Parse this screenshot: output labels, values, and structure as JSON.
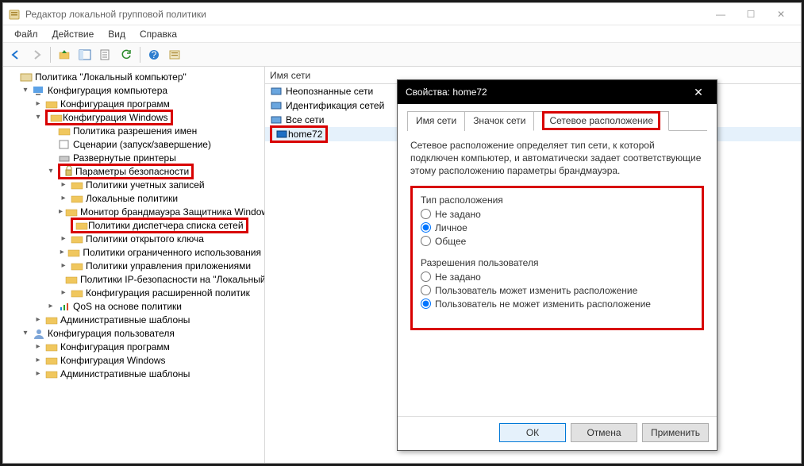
{
  "window": {
    "title": "Редактор локальной групповой политики",
    "controls": {
      "min": "—",
      "max": "☐",
      "close": "✕"
    }
  },
  "menus": [
    "Файл",
    "Действие",
    "Вид",
    "Справка"
  ],
  "tree": {
    "root": "Политика \"Локальный компьютер\"",
    "computer": "Конфигурация компьютера",
    "progconf_c": "Конфигурация программ",
    "winconf_c": "Конфигурация Windows",
    "nameres": "Политика разрешения имен",
    "scripts": "Сценарии (запуск/завершение)",
    "deployed_printers": "Развернутые принтеры",
    "secparams": "Параметры безопасности",
    "accpol": "Политики учетных записей",
    "localpol": "Локальные политики",
    "fwmon": "Монитор брандмауэра Защитника Windows",
    "netlistmgr": "Политики диспетчера списка сетей",
    "openkey": "Политики открытого ключа",
    "restricted": "Политики ограниченного использования",
    "appctrl": "Политики управления приложениями",
    "ipsec": "Политики IP-безопасности на \"Локальный",
    "advaudit": "Конфигурация расширенной политик",
    "qos": "QoS на основе политики",
    "admintpl_c": "Административные шаблоны",
    "user": "Конфигурация пользователя",
    "progconf_u": "Конфигурация программ",
    "winconf_u": "Конфигурация Windows",
    "admintpl_u": "Административные шаблоны"
  },
  "list_header": "Имя сети",
  "list_items": {
    "unid": "Неопознанные сети",
    "ident": "Идентификация сетей",
    "all": "Все сети",
    "home72": "home72"
  },
  "dialog": {
    "title": "Свойства: home72",
    "close": "✕",
    "tabs": {
      "name": "Имя сети",
      "icon": "Значок сети",
      "loc": "Сетевое расположение"
    },
    "desc": "Сетевое расположение определяет тип сети, к которой подключен компьютер, и автоматически задает соответствующие этому расположению параметры брандмауэра.",
    "group1": {
      "legend": "Тип расположения",
      "o1": "Не задано",
      "o2": "Личное",
      "o3": "Общее"
    },
    "group2": {
      "legend": "Разрешения пользователя",
      "o1": "Не задано",
      "o2": "Пользователь может изменить расположение",
      "o3": "Пользователь не может изменить расположение"
    },
    "buttons": {
      "ok": "ОК",
      "cancel": "Отмена",
      "apply": "Применить"
    }
  }
}
